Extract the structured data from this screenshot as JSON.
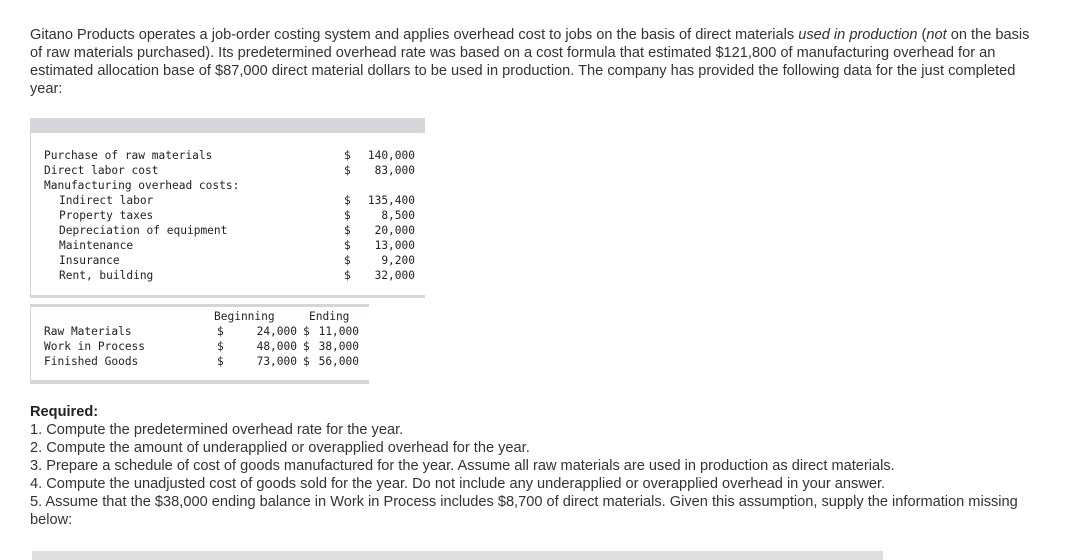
{
  "intro": {
    "p1": "Gitano Products operates a job-order costing system and applies overhead cost to jobs on the basis of direct materials ",
    "em1": "used in production",
    "p2": " (",
    "em2": "not",
    "p3": " on the basis of raw materials purchased). Its predetermined overhead rate was based on a cost formula that estimated $121,800 of manufacturing overhead for an estimated allocation base of $87,000 direct material dollars to be used in production. The company has provided the following data for the just completed year:"
  },
  "cost_table": {
    "rows": [
      {
        "label": "Purchase of raw materials",
        "dollar": "$",
        "amount": "140,000"
      },
      {
        "label": "Direct labor cost",
        "dollar": "$",
        "amount": "83,000"
      },
      {
        "label": "Manufacturing overhead costs:",
        "dollar": "",
        "amount": ""
      },
      {
        "label": "Indirect labor",
        "dollar": "$",
        "amount": "135,400"
      },
      {
        "label": "Property taxes",
        "dollar": "$",
        "amount": "8,500"
      },
      {
        "label": "Depreciation of equipment",
        "dollar": "$",
        "amount": "20,000"
      },
      {
        "label": "Maintenance",
        "dollar": "$",
        "amount": "13,000"
      },
      {
        "label": "Insurance",
        "dollar": "$",
        "amount": "9,200"
      },
      {
        "label": "Rent, building",
        "dollar": "$",
        "amount": "32,000"
      }
    ]
  },
  "inventory_table": {
    "header_beginning": "Beginning",
    "header_ending": "Ending",
    "rows": [
      {
        "label": "Raw Materials",
        "beg_dollar": "$",
        "beginning": "24,000",
        "end_dollar": "$",
        "ending": "11,000"
      },
      {
        "label": "Work in Process",
        "beg_dollar": "$",
        "beginning": "48,000",
        "end_dollar": "$",
        "ending": "38,000"
      },
      {
        "label": "Finished Goods",
        "beg_dollar": "$",
        "beginning": "73,000",
        "end_dollar": "$",
        "ending": "56,000"
      }
    ]
  },
  "required": {
    "title": "Required:",
    "items": [
      "1. Compute the predetermined overhead rate for the year.",
      "2. Compute the amount of underapplied or overapplied overhead for the year.",
      "3. Prepare a schedule of cost of goods manufactured for the year. Assume all raw materials are used in production as direct materials.",
      "4. Compute the unadjusted cost of goods sold for the year. Do not include any underapplied or overapplied overhead in your answer.",
      "5. Assume that the $38,000 ending balance in Work in Process includes $8,700 of direct materials. Given this assumption, supply the information missing below:"
    ]
  }
}
